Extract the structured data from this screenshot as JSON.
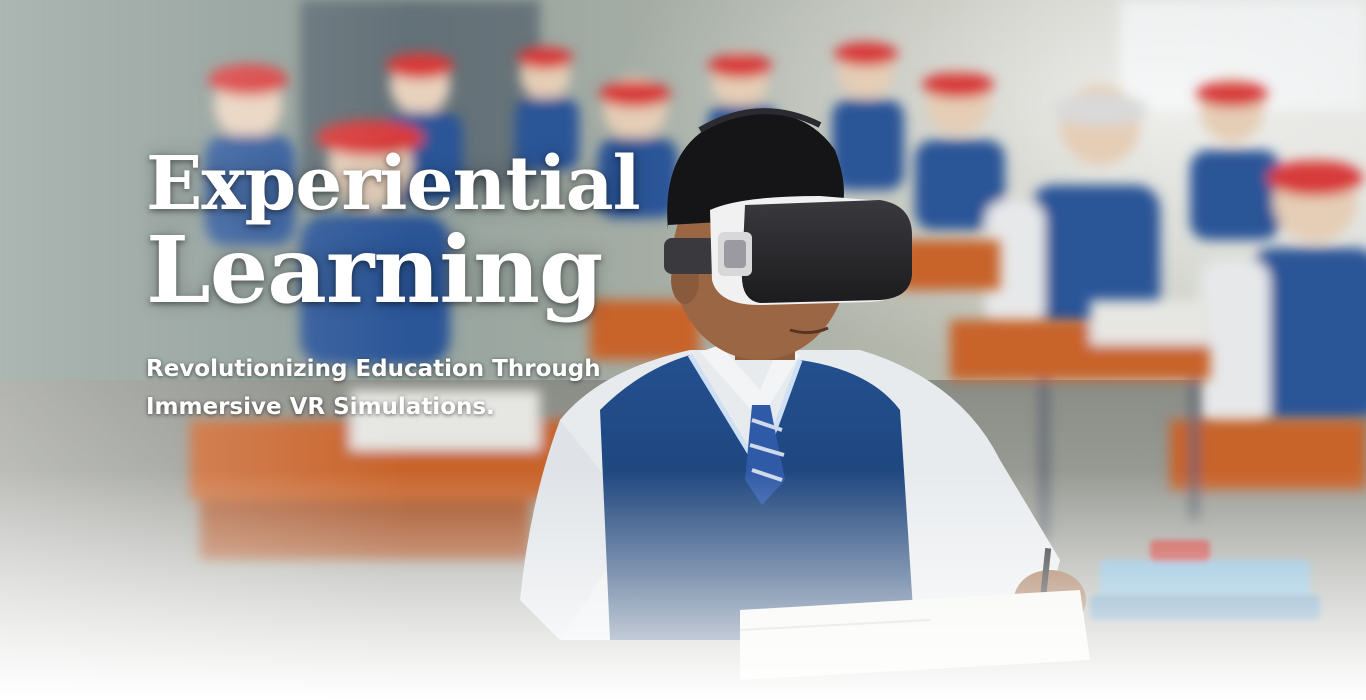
{
  "hero": {
    "title_line1": "Experiential",
    "title_line2": "Learning",
    "subtitle_line1": "Revolutionizing Education Through",
    "subtitle_line2": "Immersive VR Simulations.",
    "image_alt": "Classroom of students with a student wearing a VR headset"
  },
  "colors": {
    "title_text": "#ffffff",
    "vest_blue": "#1f4a8a",
    "desk_orange": "#c8642a",
    "headset": "#2b2b2e",
    "fade_white": "#ffffff"
  }
}
